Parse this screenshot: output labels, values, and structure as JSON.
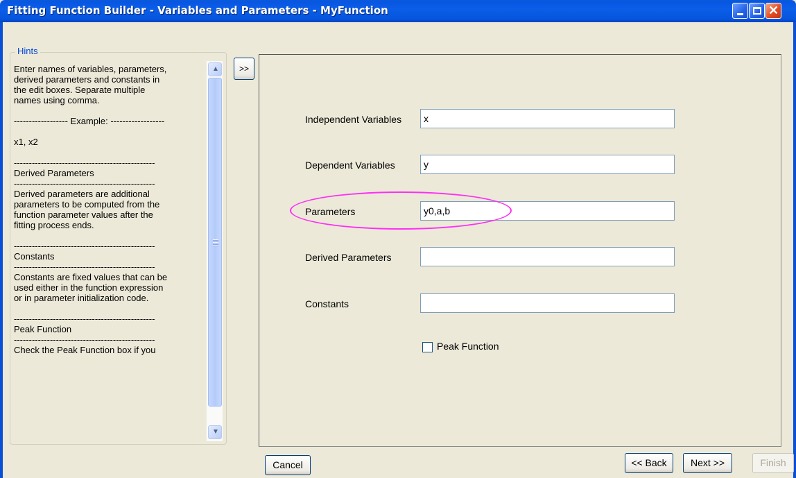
{
  "window": {
    "title": "Fitting Function Builder - Variables and Parameters - MyFunction",
    "controls": [
      "minimize-icon",
      "maximize-icon",
      "close-icon"
    ]
  },
  "hints": {
    "legend": "Hints",
    "lines": [
      "Enter names of variables, parameters,",
      "derived parameters and constants in",
      "the edit boxes. Separate multiple",
      "names using comma.",
      "",
      "------------------ Example: ------------------",
      "",
      "x1, x2",
      "",
      "-----------------------------------------------",
      "Derived Parameters",
      "-----------------------------------------------",
      "Derived parameters are additional",
      "parameters to be computed from the",
      "function parameter values after the",
      "fitting process ends.",
      "",
      "-----------------------------------------------",
      "Constants",
      "-----------------------------------------------",
      "Constants are fixed values that can be",
      "used either in the function expression",
      "or in parameter initialization code.",
      "",
      "-----------------------------------------------",
      "Peak Function",
      "-----------------------------------------------",
      "Check the Peak Function box if you"
    ]
  },
  "toggle_label": ">>",
  "fields": {
    "independent": {
      "label": "Independent Variables",
      "value": "x"
    },
    "dependent": {
      "label": "Dependent Variables",
      "value": "y"
    },
    "parameters": {
      "label": "Parameters",
      "value": "y0,a,b"
    },
    "derived": {
      "label": "Derived Parameters",
      "value": ""
    },
    "constants": {
      "label": "Constants",
      "value": ""
    }
  },
  "peak_function": {
    "label": "Peak Function",
    "checked": false
  },
  "buttons": {
    "cancel": "Cancel",
    "back": "<< Back",
    "next": "Next >>",
    "finish": "Finish"
  },
  "colors": {
    "highlight": "#ff2ef5",
    "titlebar": "#0a5ad8",
    "legend": "#0046d5"
  }
}
